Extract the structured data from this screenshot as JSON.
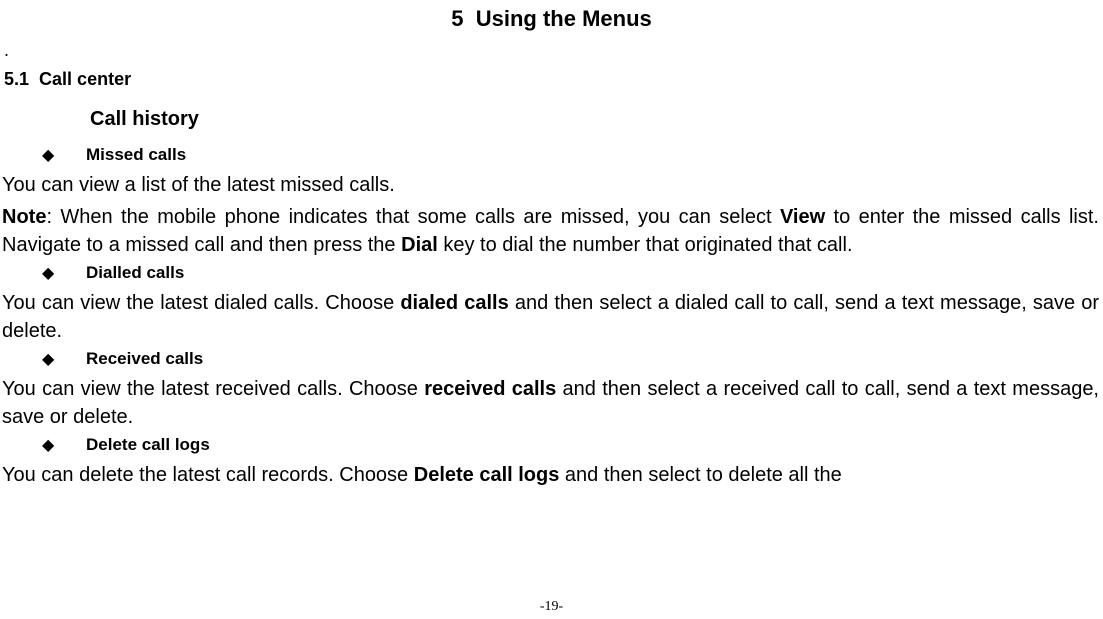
{
  "chapter": {
    "number": "5",
    "title": "Using the Menus"
  },
  "dot": ".",
  "section": {
    "number": "5.1",
    "title": "Call center"
  },
  "subsection": {
    "title": "Call history"
  },
  "missed": {
    "label": "Missed calls",
    "line1": "You can view a list of the latest missed calls.",
    "note_label": "Note",
    "note_part1": ": When the mobile phone indicates that some calls are missed, you can select ",
    "note_bold1": "View",
    "note_part2": " to enter the missed calls list. Navigate to a missed call and then press the ",
    "note_bold2": "Dial",
    "note_part3": " key to dial the number that originated that call."
  },
  "dialled": {
    "label": "Dialled calls",
    "part1": "You can view the latest dialed calls. Choose ",
    "bold1": "dialed calls",
    "part2": " and then select a dialed call to call, send a text message, save or delete."
  },
  "received": {
    "label": "Received calls",
    "part1": "You can view the latest received calls. Choose ",
    "bold1": "received calls",
    "part2": " and then select a received call to call, send a text message, save or delete."
  },
  "delete": {
    "label": "Delete call logs",
    "part1": "You can delete the latest call records. Choose ",
    "bold1": "Delete call logs",
    "part2": " and then select to delete all the"
  },
  "page_number": "-19-"
}
